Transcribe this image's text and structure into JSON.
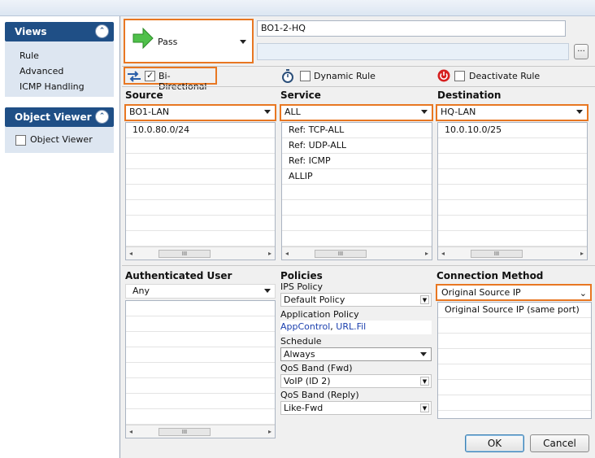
{
  "sidebar": {
    "views": {
      "title": "Views",
      "items": [
        "Rule",
        "Advanced",
        "ICMP Handling"
      ]
    },
    "object_viewer": {
      "title": "Object Viewer",
      "checkbox_label": "Object Viewer",
      "checked": false
    }
  },
  "rule": {
    "action": "Pass",
    "name": "BO1-2-HQ",
    "description": "",
    "browse_label": "..."
  },
  "options": {
    "bidirectional": {
      "label": "Bi-Directional",
      "checked": true
    },
    "dynamic_rule": {
      "label": "Dynamic Rule",
      "checked": false
    },
    "deactivate_rule": {
      "label": "Deactivate Rule",
      "checked": false
    }
  },
  "source": {
    "heading": "Source",
    "selected": "BO1-LAN",
    "entries": [
      "10.0.80.0/24"
    ]
  },
  "service": {
    "heading": "Service",
    "selected": "ALL",
    "entries": [
      "Ref: TCP-ALL",
      "Ref: UDP-ALL",
      "Ref: ICMP",
      "ALLIP"
    ]
  },
  "destination": {
    "heading": "Destination",
    "selected": "HQ-LAN",
    "entries": [
      "10.0.10.0/25"
    ]
  },
  "authenticated_user": {
    "heading": "Authenticated User",
    "selected": "Any"
  },
  "policies": {
    "heading": "Policies",
    "ips_policy": {
      "label": "IPS Policy",
      "value": "Default Policy"
    },
    "application_policy": {
      "label": "Application Policy",
      "value_a": "AppControl",
      "separator": ", ",
      "value_b": "URL.Fil"
    },
    "schedule": {
      "label": "Schedule",
      "value": "Always"
    },
    "qos_fwd": {
      "label": "QoS Band (Fwd)",
      "value": "VoIP (ID 2)"
    },
    "qos_reply": {
      "label": "QoS Band (Reply)",
      "value": "Like-Fwd"
    }
  },
  "connection_method": {
    "heading": "Connection Method",
    "selected": "Original Source IP",
    "entries": [
      "Original Source IP (same port)"
    ]
  },
  "buttons": {
    "ok": "OK",
    "cancel": "Cancel"
  },
  "scroll_thumb_glyph": "III",
  "colors": {
    "accent_orange": "#e87722",
    "panel_header": "#1f4f86",
    "panel_body": "#dde6f1",
    "link_blue": "#1a3fae",
    "pass_green": "#3fb03a"
  },
  "icons": [
    "pass-arrow-icon",
    "bidirectional-arrows-icon",
    "stopwatch-icon",
    "power-icon",
    "collapse-chevron-icon"
  ]
}
